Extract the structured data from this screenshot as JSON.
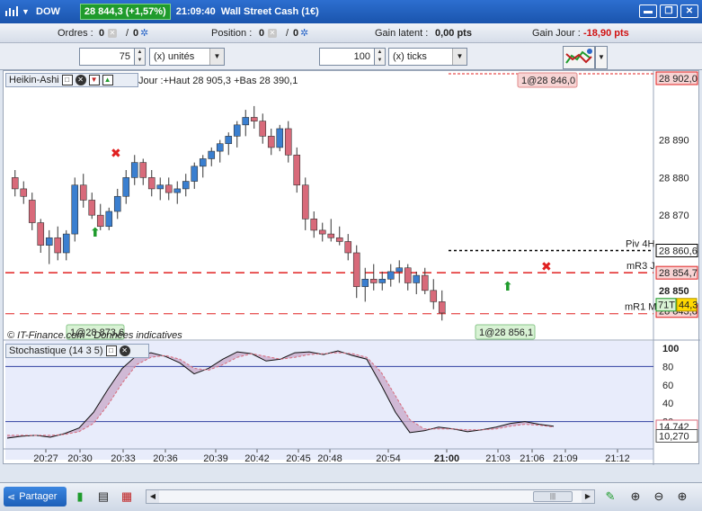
{
  "header": {
    "ticker": "DOW",
    "price_change": "28 844,3 (+1,57%)",
    "time": "21:09:40",
    "instrument": "Wall Street Cash (1€)",
    "accent_green": "#1f9b2c",
    "window_buttons": [
      "minimize-icon",
      "restore-icon",
      "close-icon"
    ]
  },
  "orders_bar": {
    "orders_label": "Ordres :",
    "orders_val_1": "0",
    "orders_sep": "/",
    "orders_val_2": "0",
    "position_label": "Position :",
    "position_val_1": "0",
    "position_sep": "/",
    "position_val_2": "0",
    "latent_label": "Gain latent :",
    "latent_val": "0,00 pts",
    "day_label": "Gain Jour :",
    "day_val": "-18,90 pts"
  },
  "controls": {
    "qty_value": "75",
    "qty_unit": "(x) unités",
    "ticks_value": "100",
    "ticks_unit": "(x) ticks"
  },
  "price_panel": {
    "title": "Heikin-Ashi",
    "info_text": "Jour :+Haut 28 905,3 +Bas 28 390,1",
    "order_top": "1@28 846,0",
    "order_bottom_left": "1@28 873,6",
    "order_bottom_right": "1@28 856,1",
    "copyright": "© IT-Finance.com - Données indicatives",
    "piv_label": "Piv 4H",
    "mr3_label": "mR3 J",
    "mr1_label": "mR1 M",
    "level_902": "28 902,0",
    "level_890": "28 890",
    "level_880": "28 880",
    "level_870": "28 870",
    "level_piv": "28 860,6",
    "level_mr3": "28 854,7",
    "level_850": "28 850",
    "level_last": "28 844,3",
    "level_mr1": "28 843,8",
    "ticks_badge": "71T",
    "ticks_badge_val": "44,3"
  },
  "stoch_panel": {
    "title": "Stochastique (14 3 5)",
    "level_100": "100",
    "level_80": "80",
    "level_60": "60",
    "level_40": "40",
    "level_20": "20",
    "value_1": "14,742",
    "value_2": "10,270"
  },
  "time_axis": {
    "labels": [
      "20:27",
      "20:30",
      "20:33",
      "20:36",
      "20:39",
      "20:42",
      "20:45",
      "20:48",
      "20:54",
      "21:00",
      "21:03",
      "21:06",
      "21:09",
      "21:12"
    ]
  },
  "bottom_bar": {
    "share_label": "Partager"
  },
  "chart_data": [
    {
      "type": "candlestick",
      "title": "Heikin-Ashi",
      "ylim": [
        28838,
        28904
      ],
      "x": [
        "20:27",
        "20:30",
        "20:33",
        "20:36",
        "20:39",
        "20:42",
        "20:45",
        "20:48",
        "20:54",
        "21:00",
        "21:03",
        "21:06",
        "21:09"
      ],
      "levels": {
        "Piv 4H": 28860.6,
        "mR3 J": 28854.7,
        "mR1 M": 28843.8
      },
      "last": 28844.3,
      "candles_ohlc": [
        [
          28880,
          28882,
          28875,
          28877
        ],
        [
          28877,
          28879,
          28873,
          28875
        ],
        [
          28874,
          28876,
          28866,
          28868
        ],
        [
          28868,
          28869,
          28860,
          28862
        ],
        [
          28862,
          28866,
          28857,
          28864
        ],
        [
          28864,
          28867,
          28858,
          28860
        ],
        [
          28860,
          28866,
          28858,
          28865
        ],
        [
          28865,
          28880,
          28863,
          28878
        ],
        [
          28878,
          28881,
          28872,
          28874
        ],
        [
          28874,
          28876,
          28869,
          28870
        ],
        [
          28870,
          28873,
          28866,
          28867
        ],
        [
          28867,
          28872,
          28866,
          28871
        ],
        [
          28871,
          28877,
          28869,
          28875
        ],
        [
          28875,
          28882,
          28873,
          28880
        ],
        [
          28880,
          28886,
          28878,
          28884
        ],
        [
          28884,
          28885,
          28878,
          28880
        ],
        [
          28880,
          28882,
          28875,
          28877
        ],
        [
          28877,
          28880,
          28874,
          28878
        ],
        [
          28878,
          28880,
          28874,
          28876
        ],
        [
          28876,
          28879,
          28873,
          28877
        ],
        [
          28877,
          28881,
          28875,
          28879
        ],
        [
          28879,
          28884,
          28877,
          28883
        ],
        [
          28883,
          28886,
          28880,
          28885
        ],
        [
          28885,
          28888,
          28883,
          28887
        ],
        [
          28887,
          28890,
          28884,
          28889
        ],
        [
          28889,
          28892,
          28886,
          28891
        ],
        [
          28891,
          28895,
          28888,
          28894
        ],
        [
          28894,
          28898,
          28891,
          28896
        ],
        [
          28896,
          28899,
          28893,
          28895
        ],
        [
          28895,
          28897,
          28889,
          28891
        ],
        [
          28891,
          28893,
          28886,
          28888
        ],
        [
          28888,
          28894,
          28887,
          28893
        ],
        [
          28893,
          28895,
          28884,
          28886
        ],
        [
          28886,
          28888,
          28876,
          28878
        ],
        [
          28878,
          28880,
          28866,
          28869
        ],
        [
          28869,
          28871,
          28864,
          28866
        ],
        [
          28866,
          28868,
          28863,
          28865
        ],
        [
          28865,
          28869,
          28863,
          28864
        ],
        [
          28864,
          28867,
          28862,
          28863
        ],
        [
          28863,
          28865,
          28858,
          28860
        ],
        [
          28860,
          28862,
          28848,
          28851
        ],
        [
          28851,
          28856,
          28847,
          28853
        ],
        [
          28853,
          28857,
          28850,
          28852
        ],
        [
          28852,
          28855,
          28850,
          28853
        ],
        [
          28853,
          28857,
          28851,
          28855
        ],
        [
          28855,
          28858,
          28852,
          28856
        ],
        [
          28856,
          28857,
          28850,
          28852
        ],
        [
          28852,
          28855,
          28849,
          28854
        ],
        [
          28854,
          28856,
          28849,
          28850
        ],
        [
          28850,
          28853,
          28845,
          28847
        ],
        [
          28847,
          28850,
          28842,
          28844
        ]
      ]
    },
    {
      "type": "line",
      "title": "Stochastique (14 3 5)",
      "ylim": [
        0,
        100
      ],
      "levels": [
        80,
        20
      ],
      "series": [
        {
          "name": "14,742",
          "values": [
            2,
            4,
            5,
            3,
            7,
            13,
            30,
            55,
            78,
            92,
            95,
            91,
            84,
            72,
            78,
            88,
            96,
            94,
            86,
            88,
            95,
            96,
            93,
            97,
            92,
            88,
            60,
            30,
            8,
            10,
            14,
            12,
            9,
            11,
            14,
            18,
            20,
            17,
            15
          ]
        },
        {
          "name": "10,270",
          "values": [
            5,
            5,
            5,
            5,
            6,
            9,
            18,
            38,
            62,
            82,
            90,
            92,
            88,
            78,
            76,
            82,
            90,
            94,
            91,
            88,
            90,
            93,
            94,
            95,
            94,
            90,
            74,
            48,
            22,
            12,
            12,
            12,
            11,
            11,
            12,
            15,
            17,
            16,
            14
          ]
        }
      ]
    }
  ]
}
